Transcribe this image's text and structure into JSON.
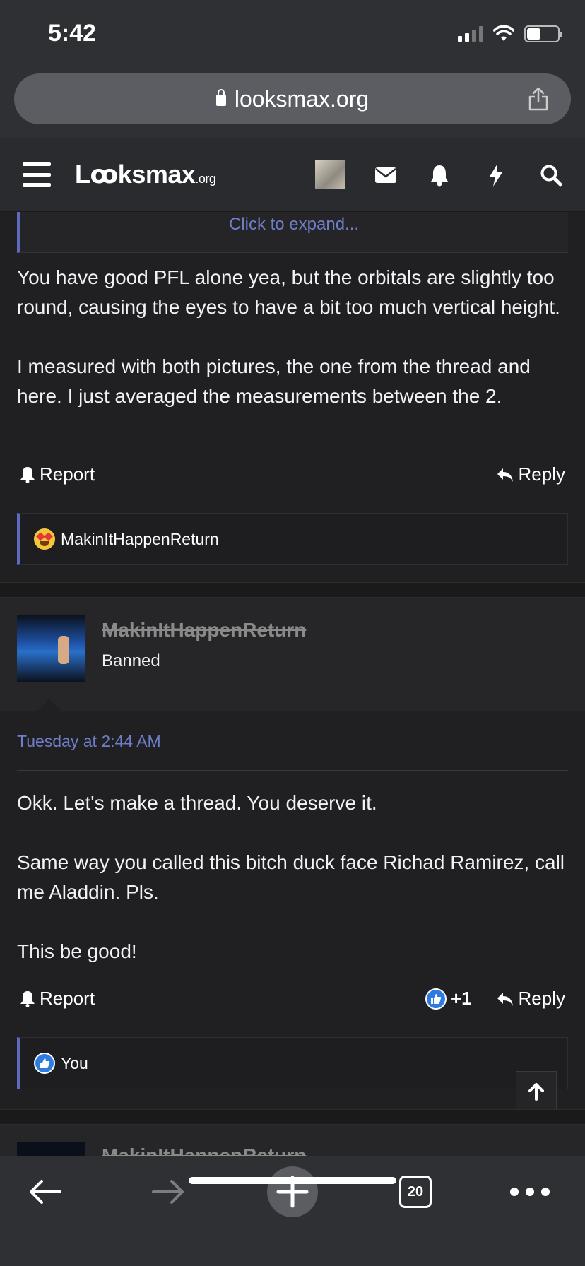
{
  "status": {
    "time": "5:42"
  },
  "browser": {
    "url": "looksmax.org",
    "tab_count": "20"
  },
  "site": {
    "logo_main": "Lꝏksmax",
    "logo_suffix": ".org"
  },
  "quote": {
    "expand_label": "Click to expand..."
  },
  "post1": {
    "paragraph1": "You have good PFL alone yea, but the orbitals are slightly too round, causing the eyes to have a bit too much vertical height.",
    "paragraph2": "I measured with both pictures, the one from the thread and here. I just averaged the measurements between the 2.",
    "report_label": "Report",
    "reply_label": "Reply",
    "reaction_users": "MakinItHappenReturn"
  },
  "post2": {
    "username": "MakinItHappenReturn",
    "user_title": "Banned",
    "date": "Tuesday at 2:44 AM",
    "paragraph1": "Okk. Let's make a thread. You deserve it.",
    "paragraph2": "Same way you called this bitch duck face Richad Ramirez, call me Aladdin. Pls.",
    "paragraph3": "This be good!",
    "report_label": "Report",
    "reply_label": "Reply",
    "like_count": "+1",
    "reaction_users": "You"
  },
  "post3": {
    "username_peek": "MakinItHappenReturn"
  },
  "colors": {
    "accent": "#5c6bc0",
    "link": "#6f7ec9",
    "background": "#202022",
    "like_blue": "#2f7ce1"
  }
}
